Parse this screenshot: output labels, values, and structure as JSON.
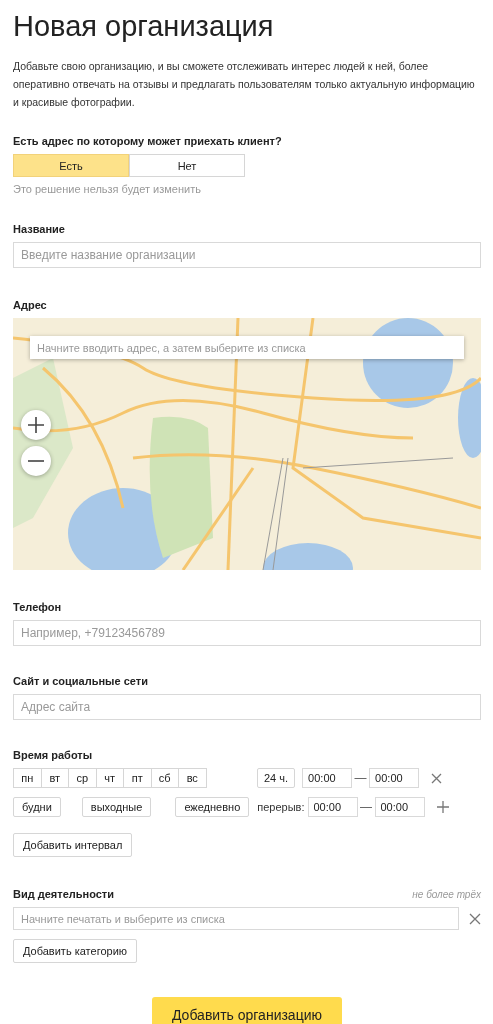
{
  "title": "Новая организация",
  "intro": "Добавьте свою организацию, и вы сможете отслеживать интерес людей к ней, более оперативно отвечать на отзывы и предлагать пользователям только актуальную информацию и красивые фотографии.",
  "address_question": {
    "label": "Есть адрес по которому может приехать клиент?",
    "options": [
      {
        "label": "Есть",
        "selected": true
      },
      {
        "label": "Нет",
        "selected": false
      }
    ],
    "hint": "Это решение нельзя будет изменить"
  },
  "name_field": {
    "label": "Название",
    "placeholder": "Введите название организации"
  },
  "address": {
    "label": "Адрес",
    "placeholder": "Начните вводить адрес, а затем выберите из списка"
  },
  "phone_field": {
    "label": "Телефон",
    "placeholder": "Например, +79123456789"
  },
  "site_field": {
    "label": "Сайт и социальные сети",
    "placeholder": "Адрес сайта"
  },
  "hours": {
    "label": "Время работы",
    "days": [
      {
        "label": "пн",
        "selected": false
      },
      {
        "label": "вт",
        "selected": false
      },
      {
        "label": "ср",
        "selected": false
      },
      {
        "label": "чт",
        "selected": false
      },
      {
        "label": "пт",
        "selected": false
      },
      {
        "label": "сб",
        "selected": false
      },
      {
        "label": "вс",
        "selected": false
      }
    ],
    "presets": [
      "будни",
      "выходные",
      "ежедневно"
    ],
    "all_day": "24 ч.",
    "open_from": "00:00",
    "separator": "—",
    "open_to": "00:00",
    "break_label": "перерыв:",
    "break_from": "00:00",
    "break_separator": "—",
    "break_to": "00:00",
    "add_interval": "Добавить интервал"
  },
  "activity": {
    "label": "Вид деятельности",
    "note": "не более трёх",
    "placeholder": "Начните печатать и выберите из списка",
    "add_button": "Добавить категорию"
  },
  "submit": "Добавить организацию"
}
